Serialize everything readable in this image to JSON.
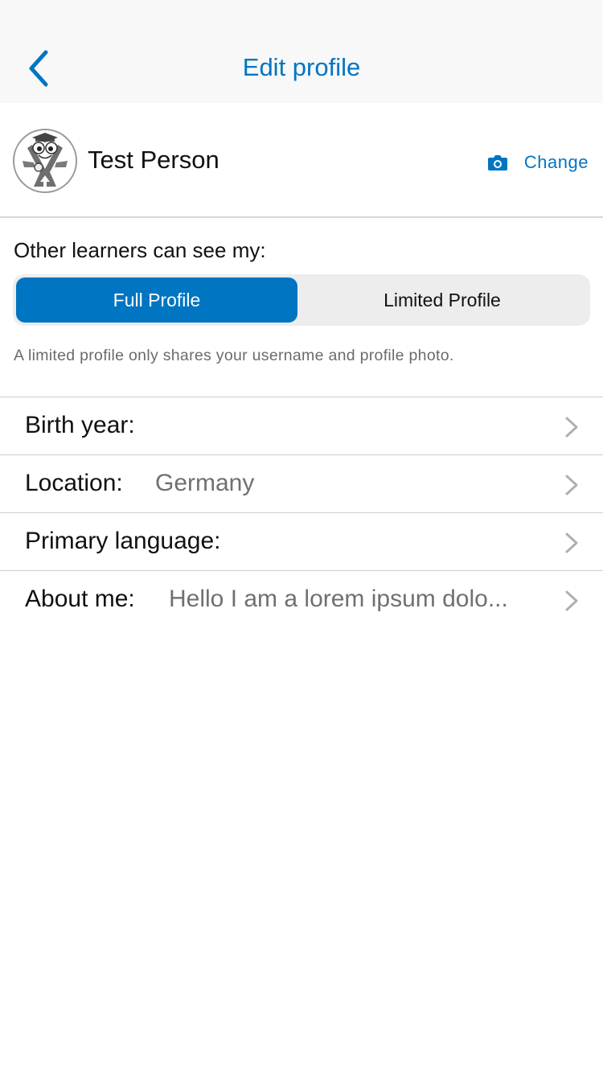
{
  "navbar": {
    "title": "Edit profile",
    "back_icon": "chevron-left-icon"
  },
  "profile": {
    "name": "Test Person",
    "avatar_icon": "mascot-avatar",
    "change_icon": "camera-icon",
    "change_label": "Change"
  },
  "visibility": {
    "label": "Other learners can see my:",
    "options": [
      "Full Profile",
      "Limited Profile"
    ],
    "selected": "Full Profile",
    "hint": "A limited profile only shares your username and profile photo."
  },
  "fields": [
    {
      "label": "Birth year:",
      "value": ""
    },
    {
      "label": "Location:",
      "value": "Germany"
    },
    {
      "label": "Primary language:",
      "value": ""
    },
    {
      "label": "About me:",
      "value": "Hello I am a lorem ipsum dolo..."
    }
  ],
  "colors": {
    "accent": "#0075c1",
    "navbar_bg": "#f8f8f8",
    "segment_bg": "#ededed",
    "secondary_text": "#707070"
  }
}
